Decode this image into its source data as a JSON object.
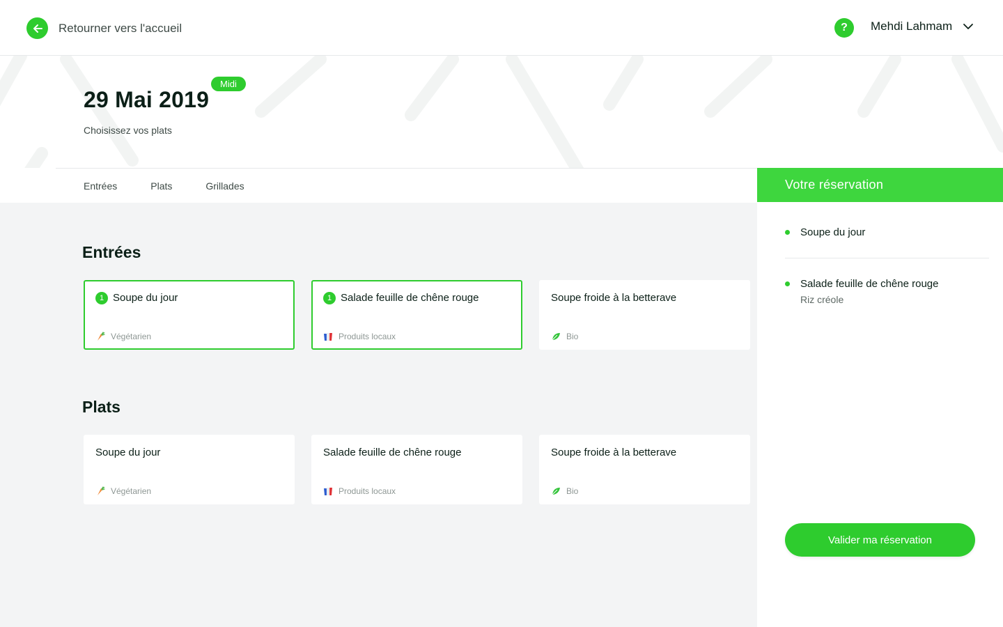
{
  "header": {
    "back_label": "Retourner vers l'accueil",
    "help_label": "?",
    "user_name": "Mehdi Lahmam"
  },
  "hero": {
    "date": "29 Mai 2019",
    "meal_badge": "Midi",
    "subtitle": "Choisissez vos plats"
  },
  "tabs": [
    {
      "label": "Entrées"
    },
    {
      "label": "Plats"
    },
    {
      "label": "Grillades"
    }
  ],
  "sections": [
    {
      "title": "Entrées",
      "items": [
        {
          "name": "Soupe du jour",
          "tag": "Végétarien",
          "tag_icon": "carrot-icon",
          "selected": true,
          "quantity": "1"
        },
        {
          "name": "Salade feuille de chêne rouge",
          "tag": "Produits locaux",
          "tag_icon": "france-map-icon",
          "selected": true,
          "quantity": "1"
        },
        {
          "name": "Soupe froide à la betterave",
          "tag": "Bio",
          "tag_icon": "leaf-icon",
          "selected": false,
          "quantity": ""
        }
      ]
    },
    {
      "title": "Plats",
      "items": [
        {
          "name": "Soupe du jour",
          "tag": "Végétarien",
          "tag_icon": "carrot-icon",
          "selected": false,
          "quantity": ""
        },
        {
          "name": "Salade feuille de chêne rouge",
          "tag": "Produits locaux",
          "tag_icon": "france-map-icon",
          "selected": false,
          "quantity": ""
        },
        {
          "name": "Soupe froide à la betterave",
          "tag": "Bio",
          "tag_icon": "leaf-icon",
          "selected": false,
          "quantity": ""
        }
      ]
    }
  ],
  "reservation": {
    "title": "Votre réservation",
    "items": [
      {
        "name": "Soupe du jour",
        "sub": ""
      },
      {
        "name": "Salade feuille de chêne rouge",
        "sub": "Riz créole"
      }
    ],
    "validate_label": "Valider ma réservation"
  },
  "colors": {
    "accent": "#2ecc2e",
    "panel_header": "#3ed63e",
    "background": "#f3f4f5"
  }
}
